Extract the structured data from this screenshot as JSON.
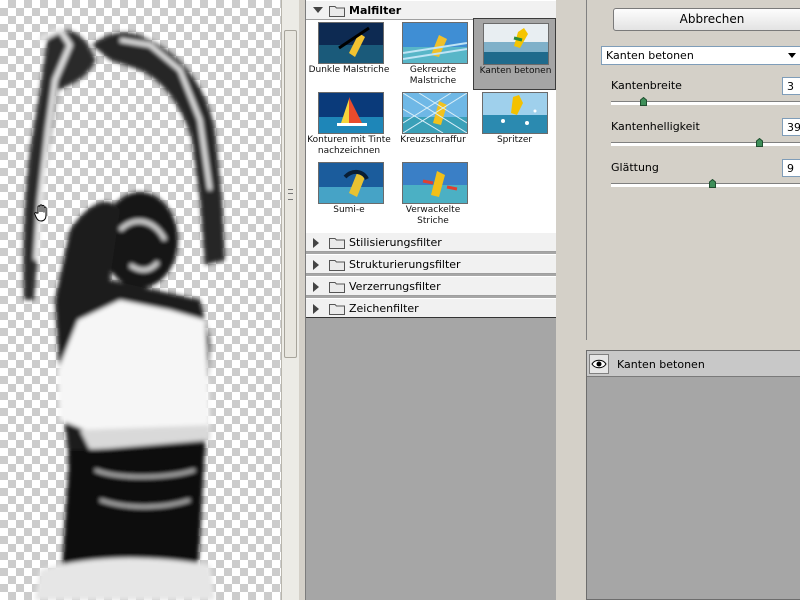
{
  "gallery": {
    "open_group": "Malfilter",
    "thumbs": [
      {
        "caption": "Dunkle Malstriche"
      },
      {
        "caption": "Gekreuzte Malstriche"
      },
      {
        "caption": "Kanten betonen"
      },
      {
        "caption": "Konturen mit Tinte nachzeichnen"
      },
      {
        "caption": "Kreuzschraffur"
      },
      {
        "caption": "Spritzer"
      },
      {
        "caption": "Sumi-e"
      },
      {
        "caption": "Verwackelte Striche"
      }
    ],
    "closed_groups": [
      {
        "label": "Stilisierungsfilter"
      },
      {
        "label": "Strukturierungsfilter"
      },
      {
        "label": "Verzerrungsfilter"
      },
      {
        "label": "Zeichenfilter"
      }
    ]
  },
  "settings": {
    "cancel_label": "Abbrechen",
    "selected_filter": "Kanten betonen",
    "params": [
      {
        "label": "Kantenbreite",
        "value": "3",
        "slider_fraction": 0.17
      },
      {
        "label": "Kantenhelligkeit",
        "value": "39",
        "slider_fraction": 0.78
      },
      {
        "label": "Glättung",
        "value": "9",
        "slider_fraction": 0.53
      }
    ]
  },
  "layers": {
    "row_label": "Kanten betonen"
  },
  "colors": {
    "panel_bg": "#d4d0c8",
    "gallery_bg": "#a6a6a6",
    "slider_thumb": "#3f8f5a"
  }
}
